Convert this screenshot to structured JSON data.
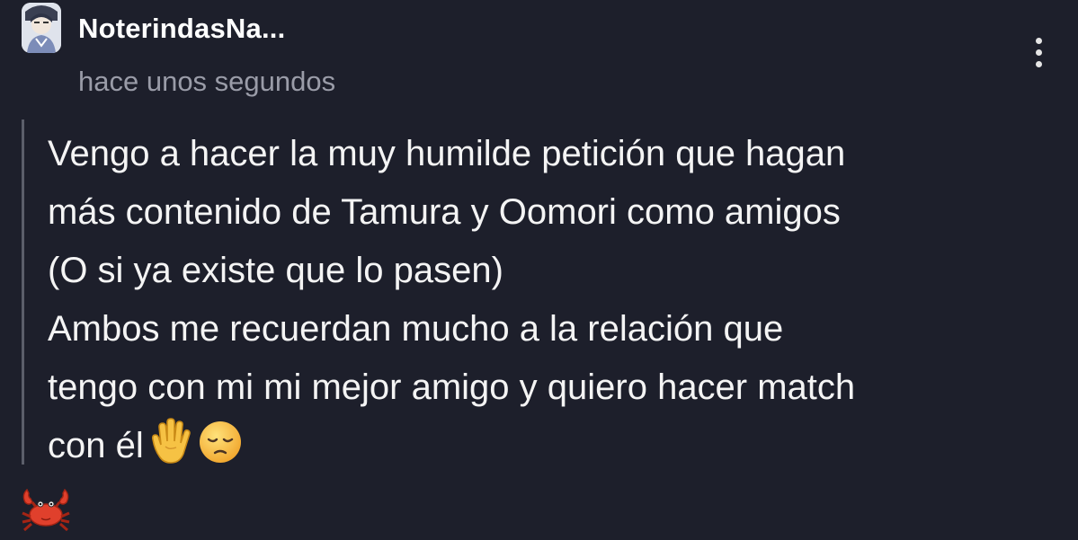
{
  "post": {
    "username": "NoterindasNa...",
    "timestamp": "hace unos segundos",
    "body": "Vengo a hacer la muy humilde petición que hagan\nmás contenido de Tamura y Oomori como amigos\n(O si ya existe que lo pasen)\nAmbos me recuerdan mucho a la relación que\ntengo con mi mi mejor amigo y quiero hacer match\ncon él",
    "body_emojis": [
      "raised-hand",
      "disappointed-face"
    ],
    "footer_emoji": "crab",
    "more_menu_icon": "vertical-ellipsis-icon"
  }
}
